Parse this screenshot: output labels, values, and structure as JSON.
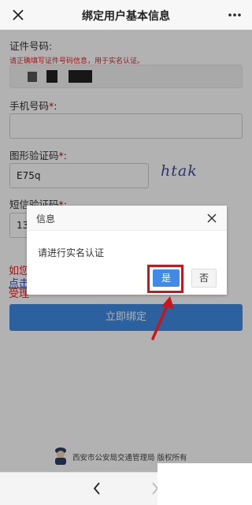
{
  "header": {
    "title": "绑定用户基本信息",
    "close_icon": "close-icon",
    "more_icon": "more-dots-icon"
  },
  "form": {
    "id_number": {
      "label": "证件号码:",
      "hint": "请正确填写证件号码信息，用于实名认证。"
    },
    "phone": {
      "label": "手机号码",
      "required_mark": "*",
      "colon": ":"
    },
    "captcha": {
      "label": "图形验证码",
      "required_mark": "*",
      "colon": ":",
      "value": "E75q",
      "image_text": "htak"
    },
    "sms": {
      "label": "短信验证码",
      "required_mark": "*",
      "colon": ":",
      "value_prefix": "13"
    },
    "side_lines": [
      "如您",
      "点击",
      "受理"
    ],
    "submit_label": "立即绑定"
  },
  "footer": {
    "text": "西安市公安局交通管理局 版权所有"
  },
  "bottom_bar": {
    "back_icon": "chevron-left-icon",
    "forward_icon": "chevron-right-icon"
  },
  "dialog": {
    "title": "信息",
    "message": "请进行实名认证",
    "yes_label": "是",
    "no_label": "否"
  },
  "colors": {
    "primary_blue": "#3f8be6",
    "required_red": "#dd0000",
    "highlight_red": "#c8161d",
    "captcha_text": "#3c4e94"
  }
}
